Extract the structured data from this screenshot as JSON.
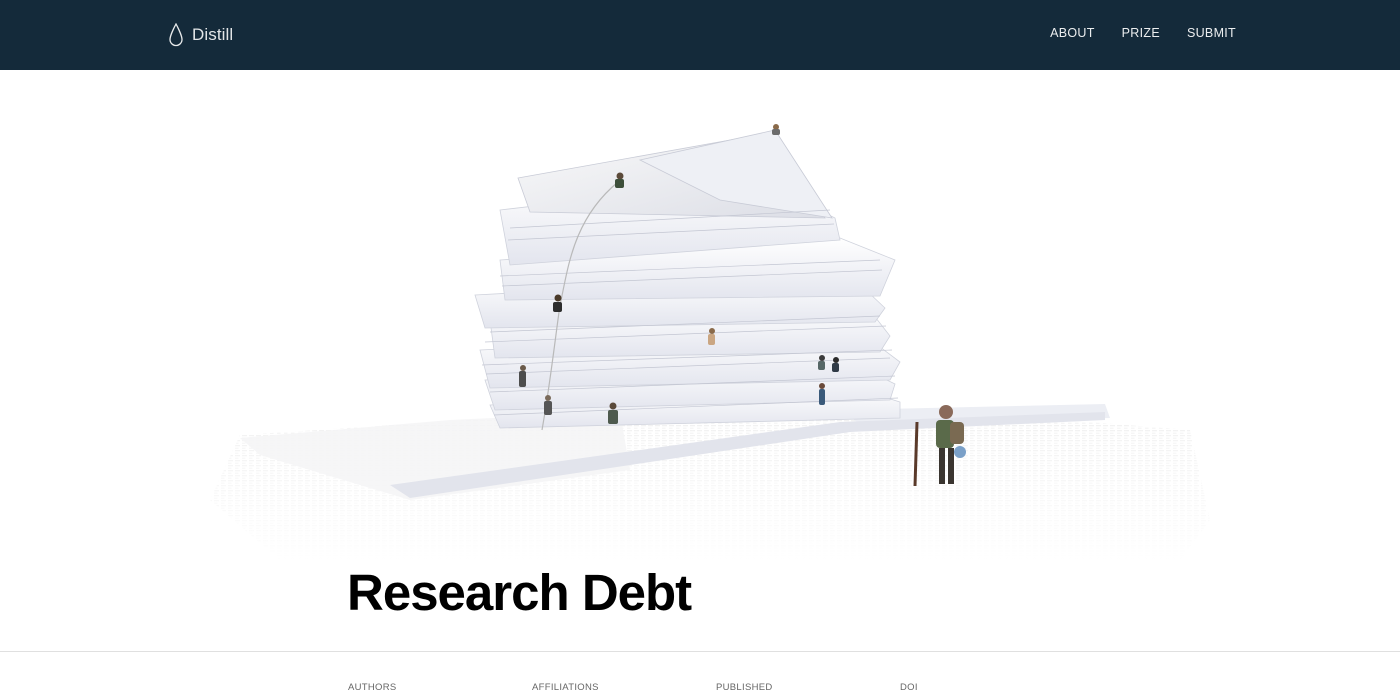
{
  "header": {
    "brand": "Distill",
    "nav": [
      {
        "label": "ABOUT"
      },
      {
        "label": "PRIZE"
      },
      {
        "label": "SUBMIT"
      }
    ],
    "background_color": "#142a3a"
  },
  "hero": {
    "icon": "paper-stack-illustration"
  },
  "article": {
    "title": "Research Debt"
  },
  "byline": {
    "headings": [
      "AUTHORS",
      "AFFILIATIONS",
      "PUBLISHED",
      "DOI"
    ]
  }
}
